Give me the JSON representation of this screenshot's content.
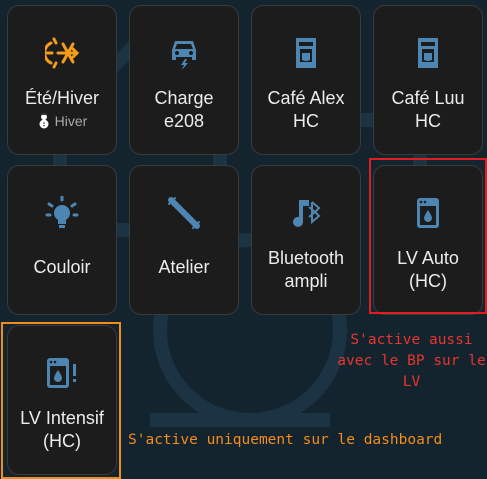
{
  "colors": {
    "background": "#14242f",
    "tile": "#1c1c1c",
    "icon_active": "#f59d1b",
    "icon_inactive": "#4d86b3",
    "highlight_red": "#e01e1e",
    "highlight_orange": "#f28c1a"
  },
  "tiles": [
    {
      "label": "Été/Hiver",
      "sub": "Hiver",
      "sub_icon": "snowman-icon",
      "icon": "sun-snowflake-icon"
    },
    {
      "label": "Charge\ne208",
      "icon": "car-charging-icon"
    },
    {
      "label": "Café Alex\nHC",
      "icon": "coffee-maker-icon"
    },
    {
      "label": "Café Luu\nHC",
      "icon": "coffee-maker-icon"
    },
    {
      "label": "Couloir",
      "icon": "light-bulb-icon"
    },
    {
      "label": "Atelier",
      "icon": "fluorescent-tube-icon"
    },
    {
      "label": "Bluetooth\nampli",
      "icon": "music-bluetooth-icon"
    },
    {
      "label": "LV Auto\n(HC)",
      "icon": "dishwasher-icon"
    },
    {
      "label": "LV Intensif\n(HC)",
      "icon": "dishwasher-alert-icon"
    }
  ],
  "annotations": {
    "red_note": "S'active aussi avec le BP sur le LV",
    "orange_note": "S'active uniquement sur le dashboard"
  }
}
